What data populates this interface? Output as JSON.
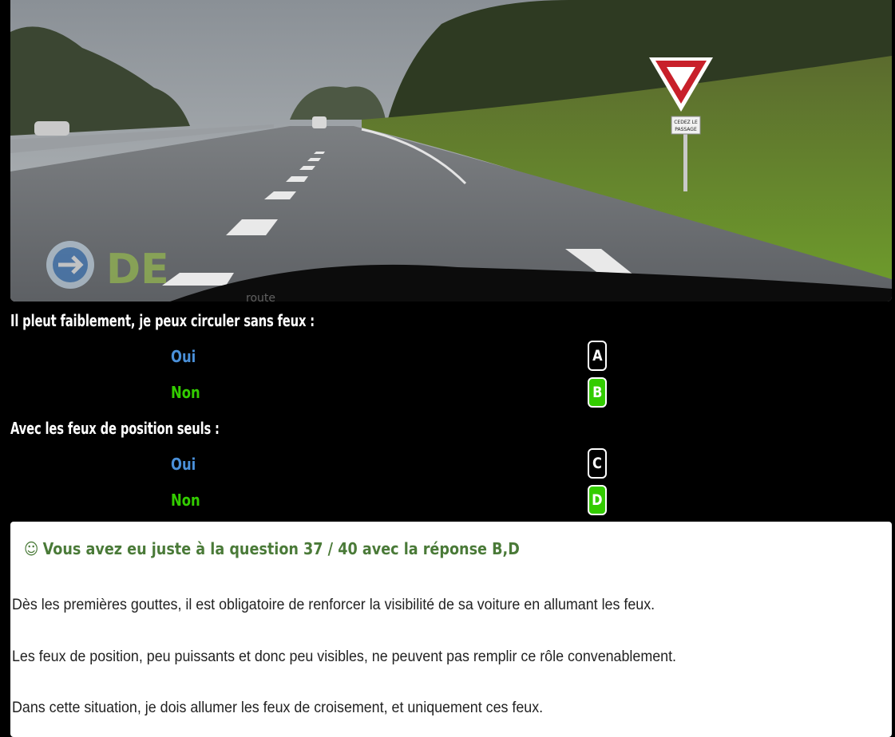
{
  "questions": [
    {
      "text": "Il pleut faiblement, je peux circuler sans feux :",
      "answers": [
        {
          "text": "Oui",
          "letter": "A",
          "selected": false
        },
        {
          "text": "Non",
          "letter": "B",
          "selected": true
        }
      ]
    },
    {
      "text": "Avec les feux de position seuls :",
      "answers": [
        {
          "text": "Oui",
          "letter": "C",
          "selected": false
        },
        {
          "text": "Non",
          "letter": "D",
          "selected": true
        }
      ]
    }
  ],
  "result": {
    "icon": "smile-icon",
    "heading": "Vous avez eu juste à la question 37 / 40 avec la réponse B,D"
  },
  "explanation": [
    "Dès les premières gouttes, il est obligatoire de renforcer la visibilité de sa voiture en allumant les feux.",
    "Les feux de position, peu puissants et donc peu visibles, ne peuvent pas remplir ce rôle convenablement.",
    "Dans cette situation, je dois allumer les feux de croisement, et uniquement ces feux."
  ],
  "photo": {
    "sign_text_line1": "CEDEZ LE",
    "sign_text_line2": "PASSAGE",
    "watermark_suffix": "route"
  },
  "colors": {
    "blue_answer": "#4a90d9",
    "green_answer": "#33cc00",
    "result_green": "#4a7a38"
  }
}
